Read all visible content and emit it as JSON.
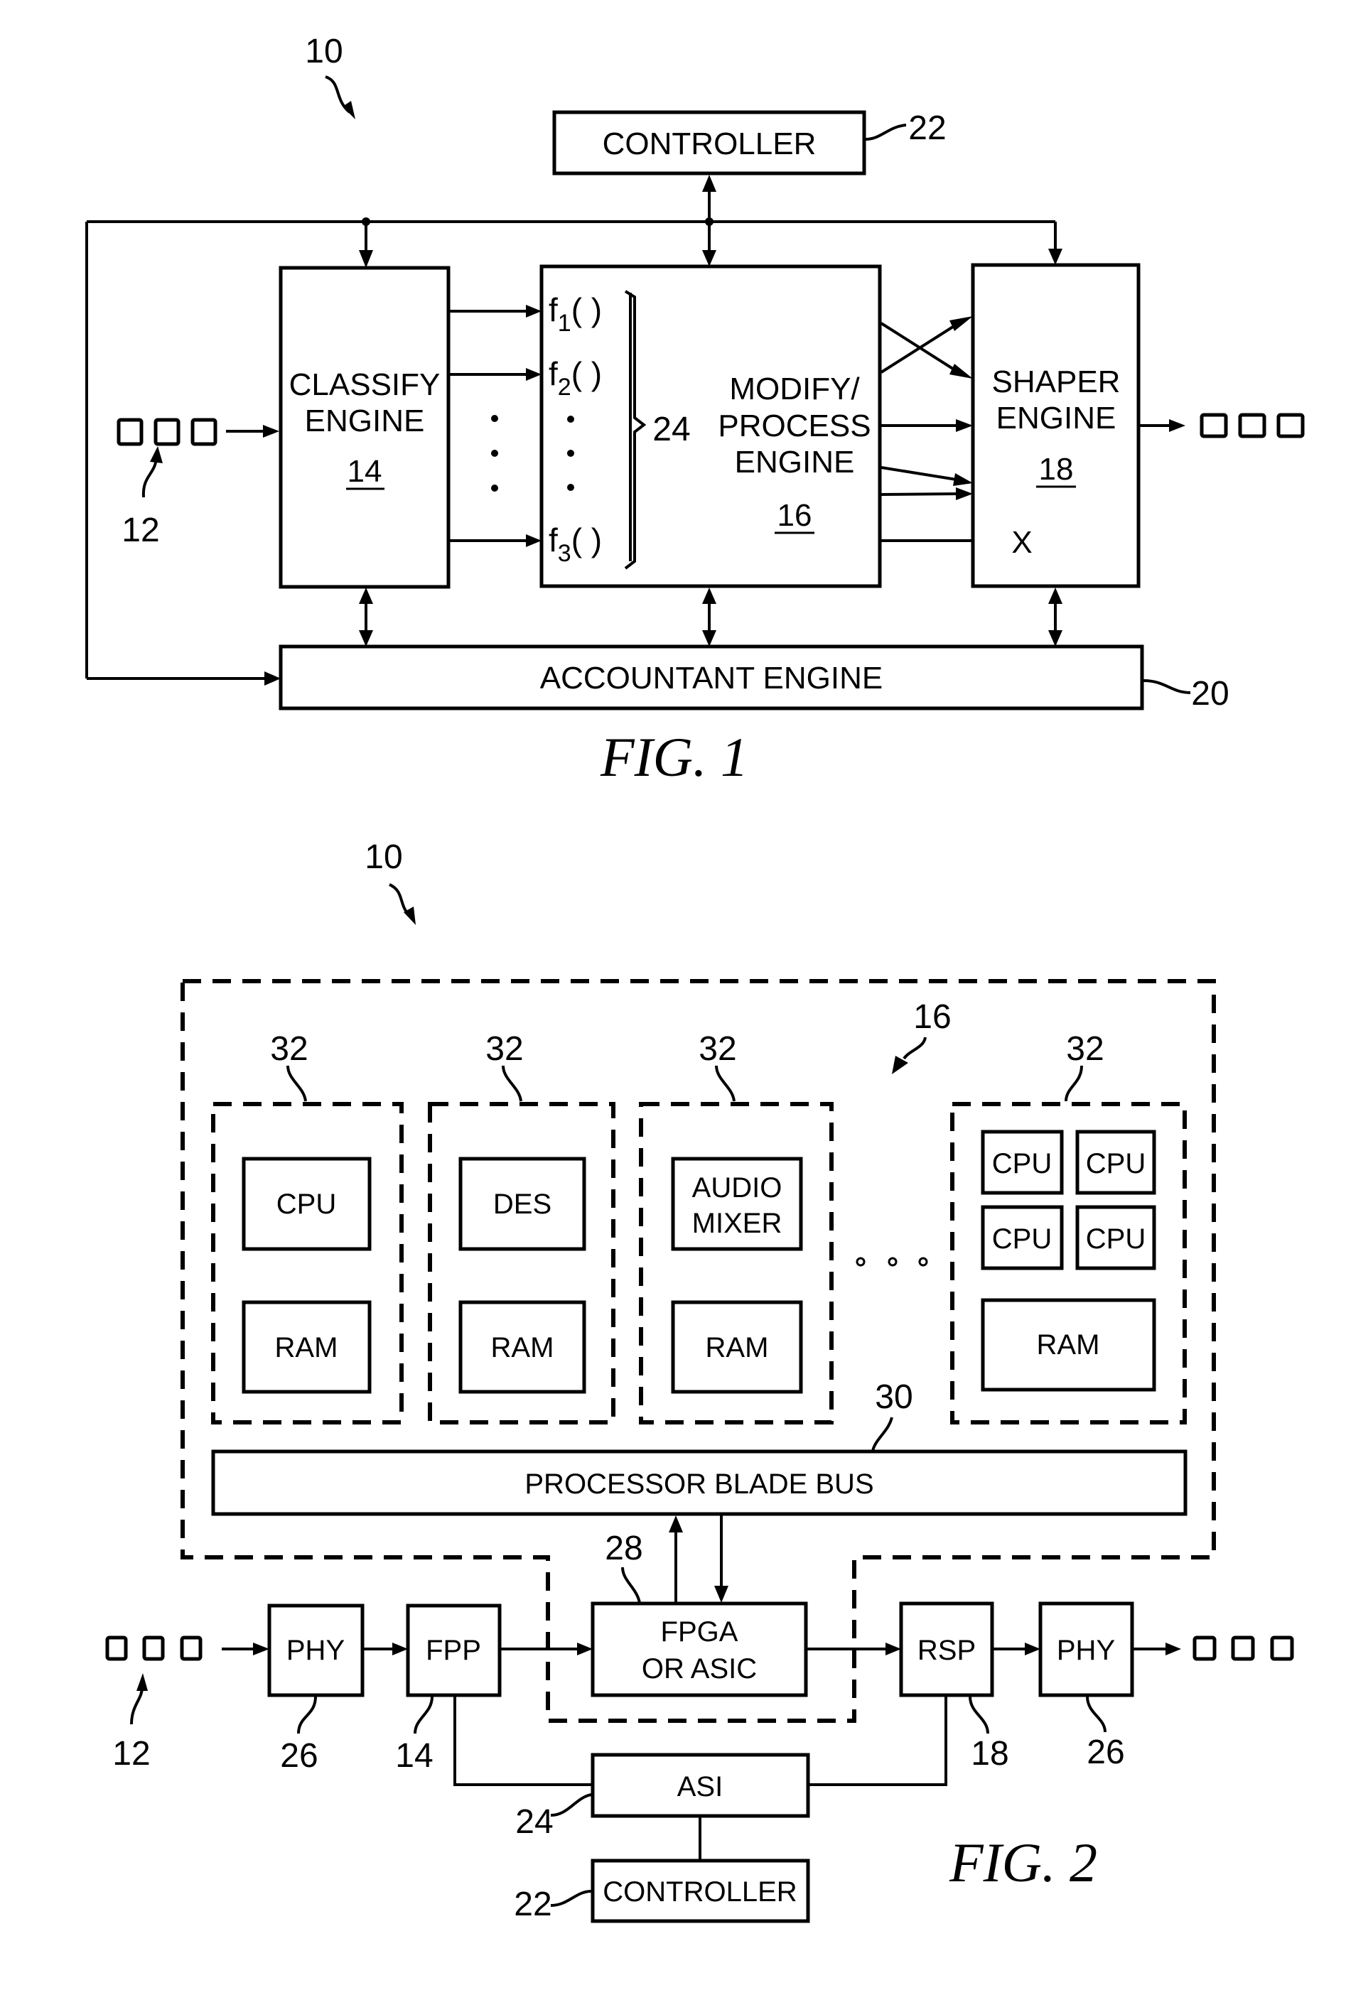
{
  "figure1": {
    "caption": "FIG. 1",
    "system_ref": "10",
    "packets_ref": "12",
    "controller": {
      "label": "CONTROLLER",
      "ref": "22"
    },
    "classify": {
      "line1": "CLASSIFY",
      "line2": "ENGINE",
      "ref": "14"
    },
    "functions": {
      "f1": "f",
      "f1_sub": "1",
      "f2": "f",
      "f2_sub": "2",
      "f3": "f",
      "f3_sub": "3",
      "parens": "( )",
      "group_ref": "24"
    },
    "modify": {
      "line1": "MODIFY/",
      "line2": "PROCESS",
      "line3": "ENGINE",
      "ref": "16"
    },
    "shaper": {
      "line1": "SHAPER",
      "line2": "ENGINE",
      "ref": "18",
      "drop": "X"
    },
    "accountant": {
      "label": "ACCOUNTANT ENGINE",
      "ref": "20"
    }
  },
  "figure2": {
    "caption": "FIG. 2",
    "system_ref": "10",
    "processor_ref": "16",
    "blades": [
      {
        "ref": "32",
        "top": "CPU",
        "bottom": "RAM"
      },
      {
        "ref": "32",
        "top": "DES",
        "bottom": "RAM"
      },
      {
        "ref": "32",
        "top_line1": "AUDIO",
        "top_line2": "MIXER",
        "bottom": "RAM"
      },
      {
        "ref": "32",
        "cpus": [
          "CPU",
          "CPU",
          "CPU",
          "CPU"
        ],
        "bottom": "RAM"
      }
    ],
    "bus": {
      "label": "PROCESSOR BLADE BUS",
      "ref": "30"
    },
    "fpga": {
      "line1": "FPGA",
      "line2": "OR ASIC",
      "ref": "28"
    },
    "phy_in": {
      "label": "PHY",
      "ref": "26"
    },
    "fpp": {
      "label": "FPP",
      "ref": "14"
    },
    "rsp": {
      "label": "RSP",
      "ref": "18"
    },
    "phy_out": {
      "label": "PHY",
      "ref": "26"
    },
    "asi": {
      "label": "ASI",
      "ref": "24"
    },
    "controller": {
      "label": "CONTROLLER",
      "ref": "22"
    },
    "packets_ref": "12"
  }
}
